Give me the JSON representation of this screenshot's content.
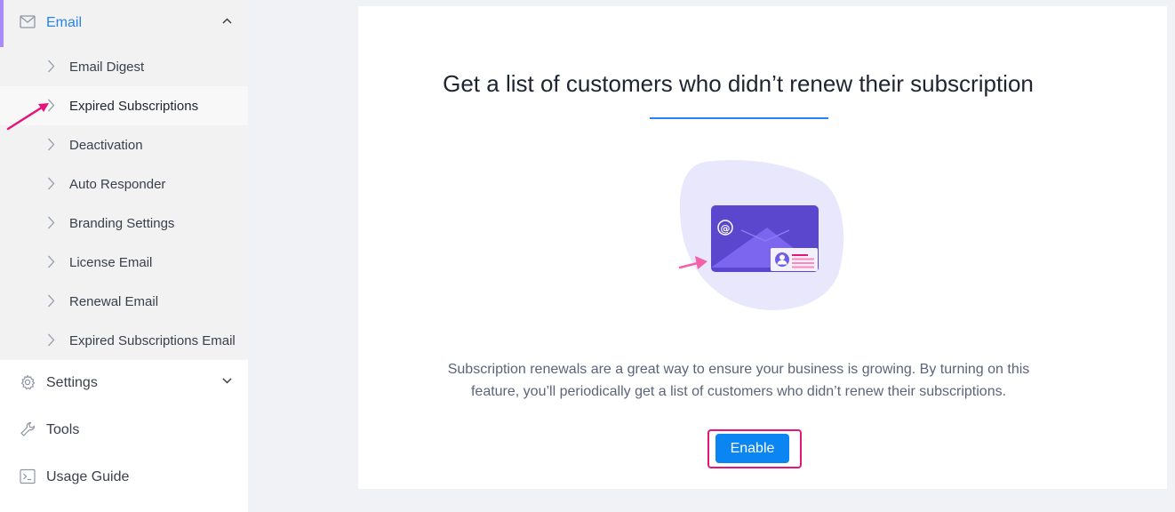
{
  "sidebar": {
    "email": {
      "label": "Email",
      "icon": "mail-icon",
      "color": "#2684f0"
    },
    "email_items": [
      {
        "label": "Email Digest"
      },
      {
        "label": "Expired Subscriptions"
      },
      {
        "label": "Deactivation"
      },
      {
        "label": "Auto Responder"
      },
      {
        "label": "Branding Settings"
      },
      {
        "label": "License Email"
      },
      {
        "label": "Renewal Email"
      },
      {
        "label": "Expired Subscriptions Email"
      }
    ],
    "settings": {
      "label": "Settings",
      "icon": "gear-icon"
    },
    "tools": {
      "label": "Tools",
      "icon": "wrench-icon"
    },
    "usage_guide": {
      "label": "Usage Guide",
      "icon": "terminal-icon"
    }
  },
  "main": {
    "title": "Get a list of customers who didn’t renew their subscription",
    "description": "Subscription renewals are a great way to ensure your business is growing. By turning on this feature, you’ll periodically get a list of customers who didn’t renew their subscriptions.",
    "enable_label": "Enable",
    "illustration_icon": "envelope-illustration",
    "accent_color": "#0a85f2",
    "highlight_color": "#e6157a"
  }
}
